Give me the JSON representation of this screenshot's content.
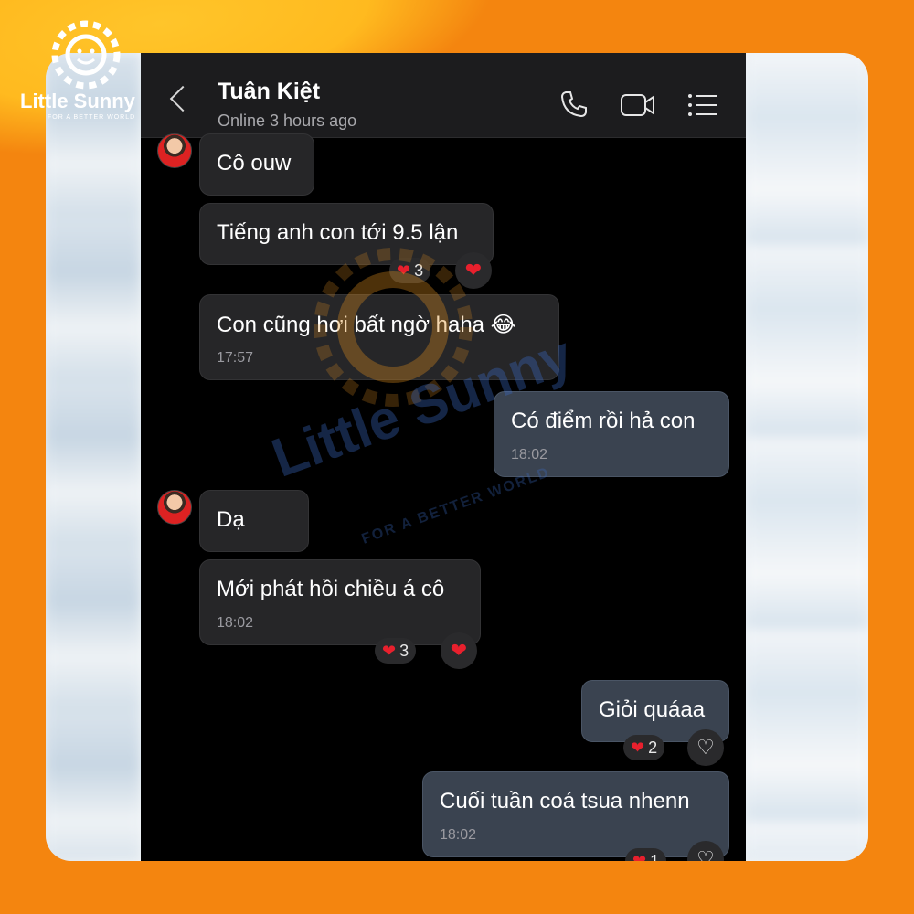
{
  "brand": {
    "name": "Little Sunny",
    "tagline": "FOR A BETTER WORLD"
  },
  "header": {
    "contact_name": "Tuân Kiệt",
    "status": "Online 3 hours ago"
  },
  "messages": [
    {
      "text": "Cô ouw"
    },
    {
      "text": "Tiếng anh con tới 9.5 lận",
      "reaction_count": "3"
    },
    {
      "text": "Con cũng hơi bất ngờ haha 😂",
      "time": "17:57"
    },
    {
      "text": "Có điểm rồi hả con",
      "time": "18:02"
    },
    {
      "text": "Dạ"
    },
    {
      "text": "Mới phát hồi chiều á cô",
      "time": "18:02",
      "reaction_count": "3"
    },
    {
      "text": "Giỏi quáaa",
      "reaction_count": "2"
    },
    {
      "text": "Cuối tuần coá tsua nhenn",
      "time": "18:02",
      "reaction_count": "1"
    }
  ],
  "colors": {
    "background": "#f4850f",
    "incoming": "#262628",
    "outgoing": "#3a4350",
    "heart": "#e8202d"
  }
}
